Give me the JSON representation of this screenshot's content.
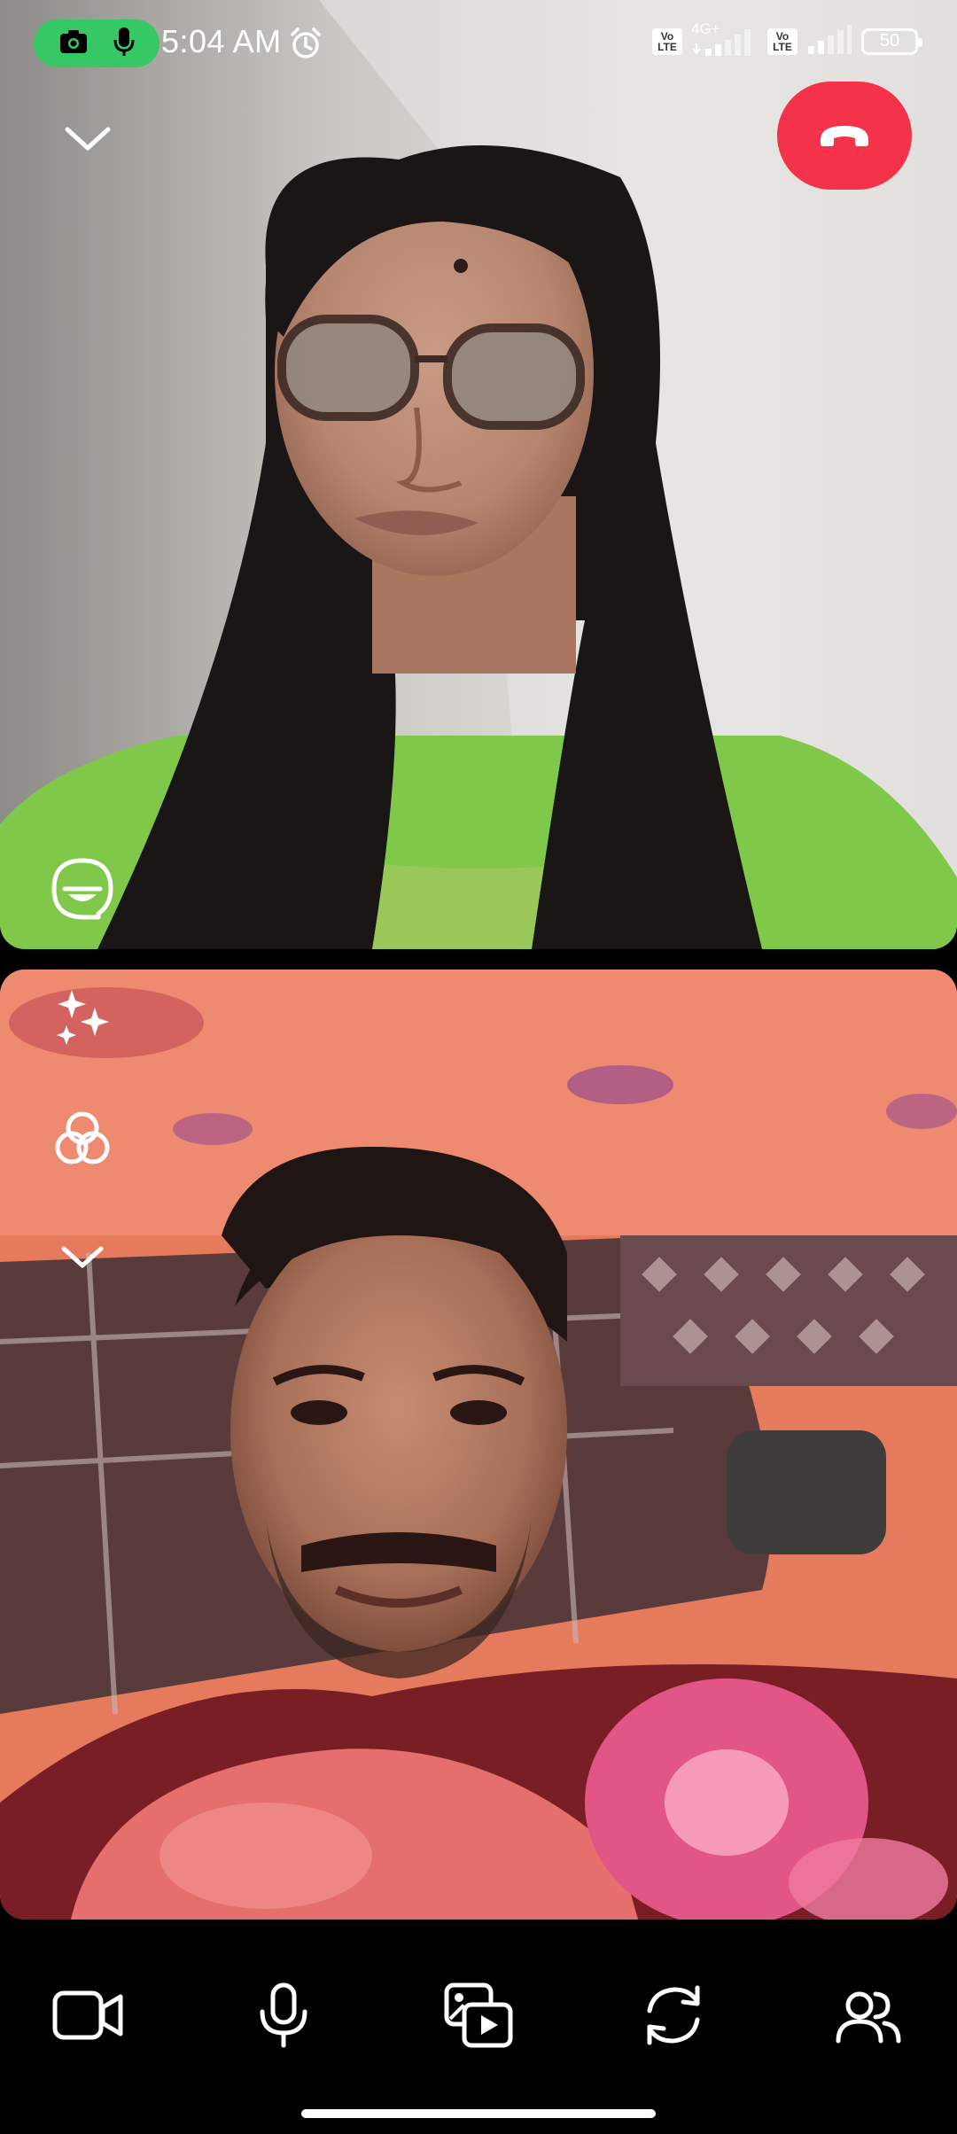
{
  "status_bar": {
    "time": "5:04 AM",
    "sim1_badge": "Vo LTE",
    "network_type": "4G+",
    "sim2_badge": "Vo LTE",
    "battery_level": "50",
    "privacy_indicator_color": "#36c865",
    "icons": [
      "camera-icon",
      "microphone-icon",
      "alarm-icon",
      "signal-icon",
      "battery-icon"
    ]
  },
  "call": {
    "end_call_color": "#f4334a",
    "remote_feed_name": "remote-video",
    "local_feed_name": "self-video"
  },
  "overlay_icons": {
    "collapse": "chevron-down-icon",
    "end_call": "phone-hangup-icon",
    "sticker": "sticker-icon",
    "effects": "sparkle-icon",
    "lens": "lens-filter-icon",
    "expand_tools": "chevron-down-icon"
  },
  "controls": [
    {
      "name": "camera",
      "icon": "video-camera-icon"
    },
    {
      "name": "microphone",
      "icon": "microphone-icon"
    },
    {
      "name": "media-share",
      "icon": "media-share-icon"
    },
    {
      "name": "flip-camera",
      "icon": "flip-camera-icon"
    },
    {
      "name": "participants",
      "icon": "participants-icon"
    }
  ]
}
